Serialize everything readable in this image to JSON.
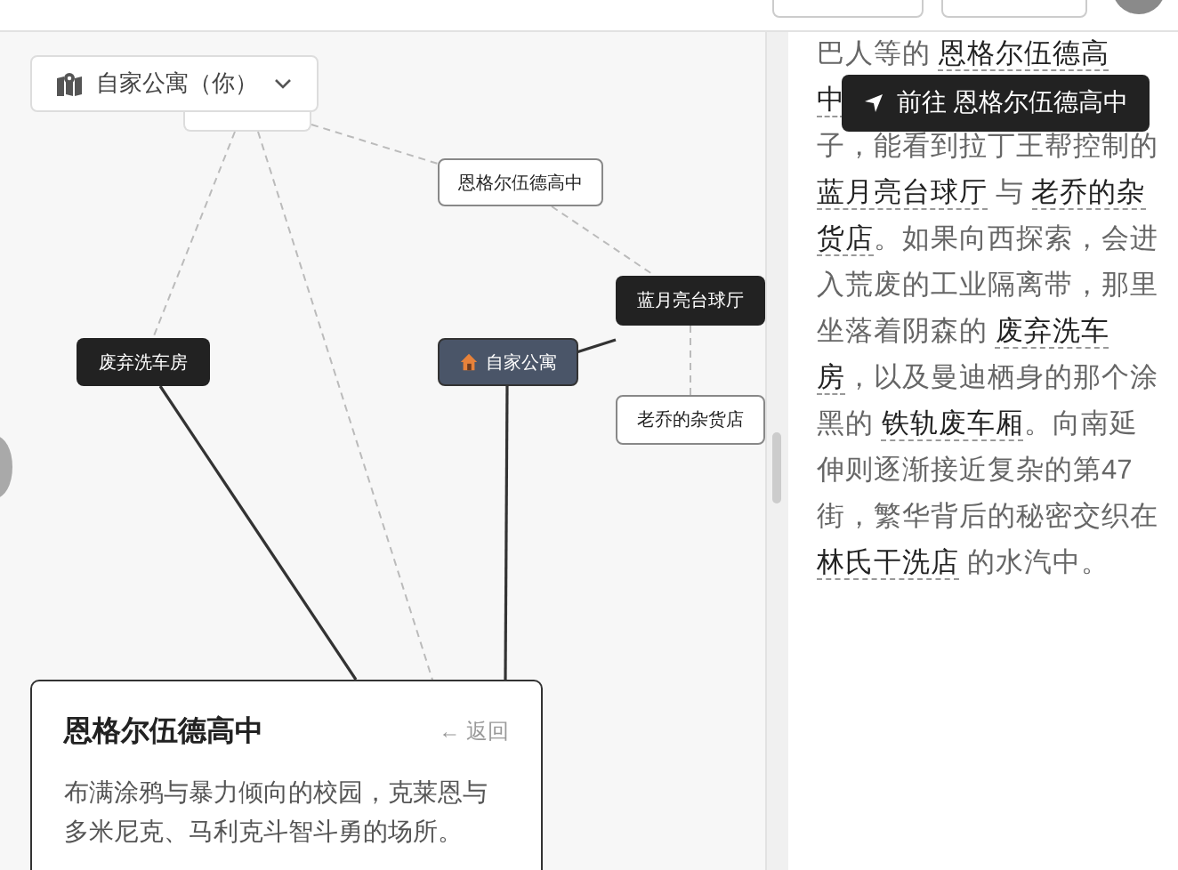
{
  "location_select": {
    "value": "自家公寓（你）"
  },
  "map": {
    "nodes": [
      {
        "label": "恩格尔伍德高中",
        "kind": "light"
      },
      {
        "label": "蓝月亮台球厅",
        "kind": "dark"
      },
      {
        "label": "废弃洗车房",
        "kind": "dark"
      },
      {
        "label": "自家公寓",
        "kind": "current"
      },
      {
        "label": "老乔的杂货店",
        "kind": "light"
      }
    ]
  },
  "detail_card": {
    "title": "恩格尔伍德高中",
    "back": "← 返回",
    "description": "布满涂鸦与暴力倾向的校园，克莱恩与多米尼克、马利克斗智斗勇的场所。"
  },
  "tooltip": {
    "label": "前往 恩格尔伍德高中"
  },
  "description_lines": [
    [
      {
        "text": "巴人等的 ",
        "link": false
      },
      {
        "text": "恩格尔伍德高",
        "link": true
      }
    ],
    [
      {
        "text": "中",
        "link": true
      }
    ],
    [
      {
        "text": "子，能看到拉丁王帮控制的",
        "link": false
      }
    ],
    [
      {
        "text": "蓝月亮台球厅",
        "link": true
      },
      {
        "text": " 与 ",
        "link": false
      },
      {
        "text": "老乔的杂",
        "link": true
      }
    ],
    [
      {
        "text": "货店",
        "link": true
      },
      {
        "text": "。如果向西探索，会进",
        "link": false
      }
    ],
    [
      {
        "text": "入荒废的工业隔离带，那里",
        "link": false
      }
    ],
    [
      {
        "text": "坐落着阴森的 ",
        "link": false
      },
      {
        "text": "废弃洗车",
        "link": true
      }
    ],
    [
      {
        "text": "房",
        "link": true
      },
      {
        "text": "，以及曼迪栖身的那个涂",
        "link": false
      }
    ],
    [
      {
        "text": "黑的 ",
        "link": false
      },
      {
        "text": "铁轨废车厢",
        "link": true
      },
      {
        "text": "。向南延",
        "link": false
      }
    ],
    [
      {
        "text": "伸则逐渐接近复杂的第47",
        "link": false
      }
    ],
    [
      {
        "text": "街，繁华背后的秘密交织在",
        "link": false
      }
    ],
    [
      {
        "text": "林氏干洗店",
        "link": true
      },
      {
        "text": " 的水汽中。",
        "link": false
      }
    ]
  ]
}
